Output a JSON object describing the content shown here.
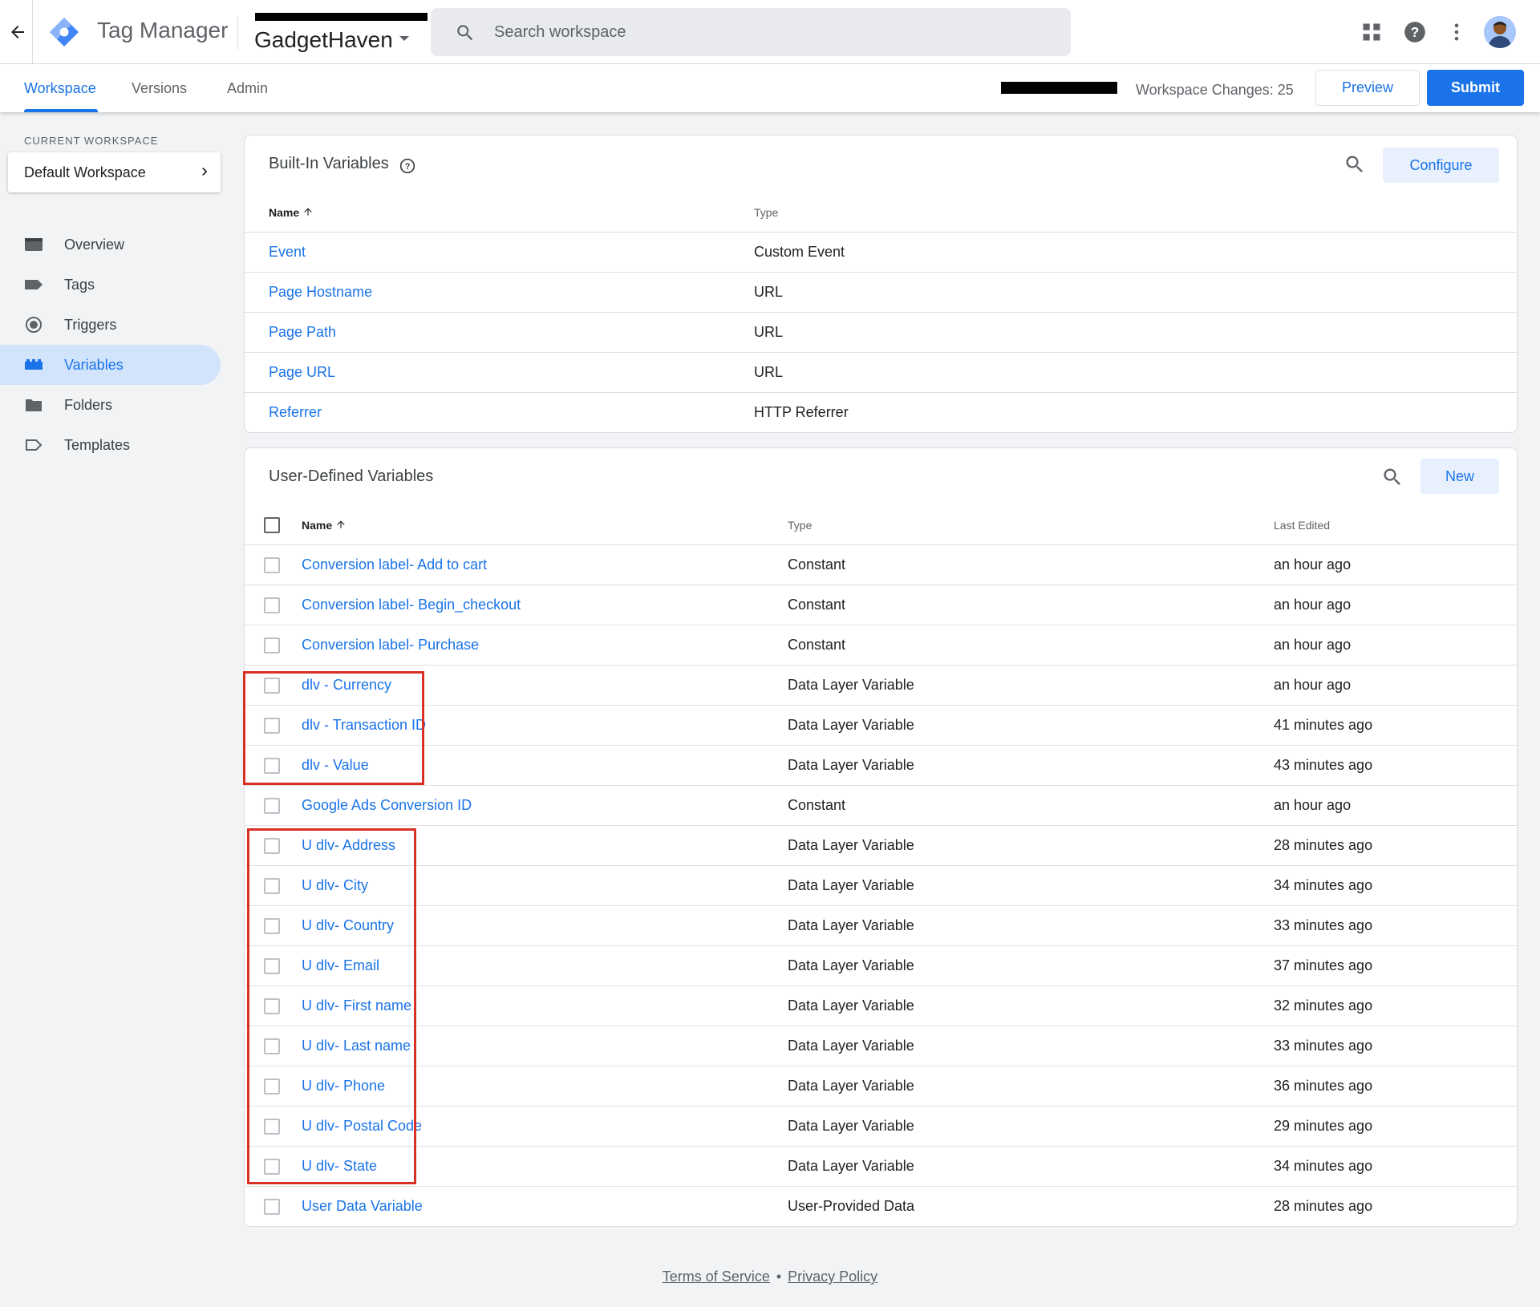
{
  "header": {
    "product_name": "Tag Manager",
    "container_name": "GadgetHaven",
    "search_placeholder": "Search workspace"
  },
  "tabs": [
    {
      "label": "Workspace",
      "active": true
    },
    {
      "label": "Versions",
      "active": false
    },
    {
      "label": "Admin",
      "active": false
    }
  ],
  "toolbar": {
    "workspace_changes": "Workspace Changes: 25",
    "preview_label": "Preview",
    "submit_label": "Submit"
  },
  "sidebar": {
    "current_workspace_label": "CURRENT WORKSPACE",
    "workspace_name": "Default Workspace",
    "items": [
      {
        "label": "Overview",
        "icon": "overview-icon",
        "active": false
      },
      {
        "label": "Tags",
        "icon": "tag-icon",
        "active": false
      },
      {
        "label": "Triggers",
        "icon": "trigger-icon",
        "active": false
      },
      {
        "label": "Variables",
        "icon": "variables-icon",
        "active": true
      },
      {
        "label": "Folders",
        "icon": "folder-icon",
        "active": false
      },
      {
        "label": "Templates",
        "icon": "template-icon",
        "active": false
      }
    ]
  },
  "builtin": {
    "title": "Built-In Variables",
    "configure_label": "Configure",
    "col_name": "Name",
    "col_type": "Type",
    "rows": [
      {
        "name": "Event",
        "type": "Custom Event"
      },
      {
        "name": "Page Hostname",
        "type": "URL"
      },
      {
        "name": "Page Path",
        "type": "URL"
      },
      {
        "name": "Page URL",
        "type": "URL"
      },
      {
        "name": "Referrer",
        "type": "HTTP Referrer"
      }
    ]
  },
  "userdefined": {
    "title": "User-Defined Variables",
    "new_label": "New",
    "col_name": "Name",
    "col_type": "Type",
    "col_edited": "Last Edited",
    "rows": [
      {
        "name": "Conversion label- Add to cart",
        "type": "Constant",
        "edited": "an hour ago"
      },
      {
        "name": "Conversion label- Begin_checkout",
        "type": "Constant",
        "edited": "an hour ago"
      },
      {
        "name": "Conversion label- Purchase",
        "type": "Constant",
        "edited": "an hour ago"
      },
      {
        "name": "dlv - Currency",
        "type": "Data Layer Variable",
        "edited": "an hour ago"
      },
      {
        "name": "dlv - Transaction ID",
        "type": "Data Layer Variable",
        "edited": "41 minutes ago"
      },
      {
        "name": "dlv - Value",
        "type": "Data Layer Variable",
        "edited": "43 minutes ago"
      },
      {
        "name": "Google Ads Conversion ID",
        "type": "Constant",
        "edited": "an hour ago"
      },
      {
        "name": "U dlv- Address",
        "type": "Data Layer Variable",
        "edited": "28 minutes ago"
      },
      {
        "name": "U dlv- City",
        "type": "Data Layer Variable",
        "edited": "34 minutes ago"
      },
      {
        "name": "U dlv- Country",
        "type": "Data Layer Variable",
        "edited": "33 minutes ago"
      },
      {
        "name": "U dlv- Email",
        "type": "Data Layer Variable",
        "edited": "37 minutes ago"
      },
      {
        "name": "U dlv- First name",
        "type": "Data Layer Variable",
        "edited": "32 minutes ago"
      },
      {
        "name": "U dlv- Last name",
        "type": "Data Layer Variable",
        "edited": "33 minutes ago"
      },
      {
        "name": "U dlv- Phone",
        "type": "Data Layer Variable",
        "edited": "36 minutes ago"
      },
      {
        "name": "U dlv- Postal Code",
        "type": "Data Layer Variable",
        "edited": "29 minutes ago"
      },
      {
        "name": "U dlv- State",
        "type": "Data Layer Variable",
        "edited": "34 minutes ago"
      },
      {
        "name": "User Data Variable",
        "type": "User-Provided Data",
        "edited": "28 minutes ago"
      }
    ]
  },
  "footer": {
    "terms": "Terms of Service",
    "separator": "•",
    "privacy": "Privacy Policy"
  },
  "colors": {
    "accent": "#1a73e8",
    "highlight_box": "#d93025",
    "active_nav_bg": "#d2e3fc"
  }
}
